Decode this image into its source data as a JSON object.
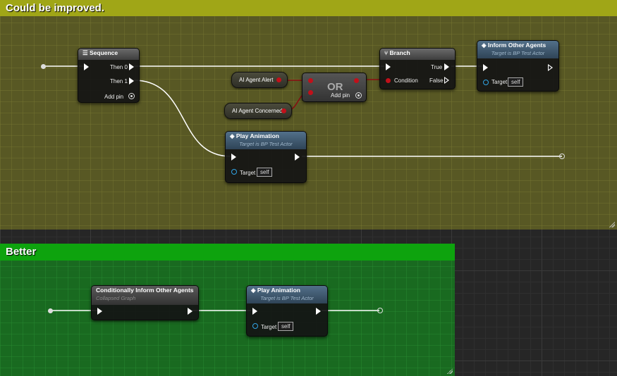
{
  "comments": {
    "top_title": "Could be improved.",
    "bottom_title": "Better"
  },
  "colors": {
    "top_comment": "#a0a617",
    "bottom_comment": "#0ea30e",
    "exec_wire": "#ffffff",
    "bool_wire": "#8a0b12",
    "object_pin": "#31a5e6"
  },
  "sequence": {
    "title": "Sequence",
    "then0": "Then 0",
    "then1": "Then 1",
    "add_pin": "Add pin"
  },
  "var_alert": "AI Agent Alert",
  "var_concerned": "AI Agent Concerned",
  "or_node": {
    "title": "OR",
    "add_pin": "Add pin"
  },
  "branch": {
    "title": "Branch",
    "condition": "Condition",
    "true_label": "True",
    "false_label": "False"
  },
  "inform": {
    "title": "Inform Other Agents",
    "subtitle": "Target is BP Test Actor",
    "target": "Target",
    "self": "self"
  },
  "play_top": {
    "title": "Play Animation",
    "subtitle": "Target is BP Test Actor",
    "target": "Target",
    "self": "self"
  },
  "conditional": {
    "title": "Conditionally Inform Other Agents",
    "subtitle": "Collapsed Graph"
  },
  "play_bottom": {
    "title": "Play Animation",
    "subtitle": "Target is BP Test Actor",
    "target": "Target",
    "self": "self"
  }
}
